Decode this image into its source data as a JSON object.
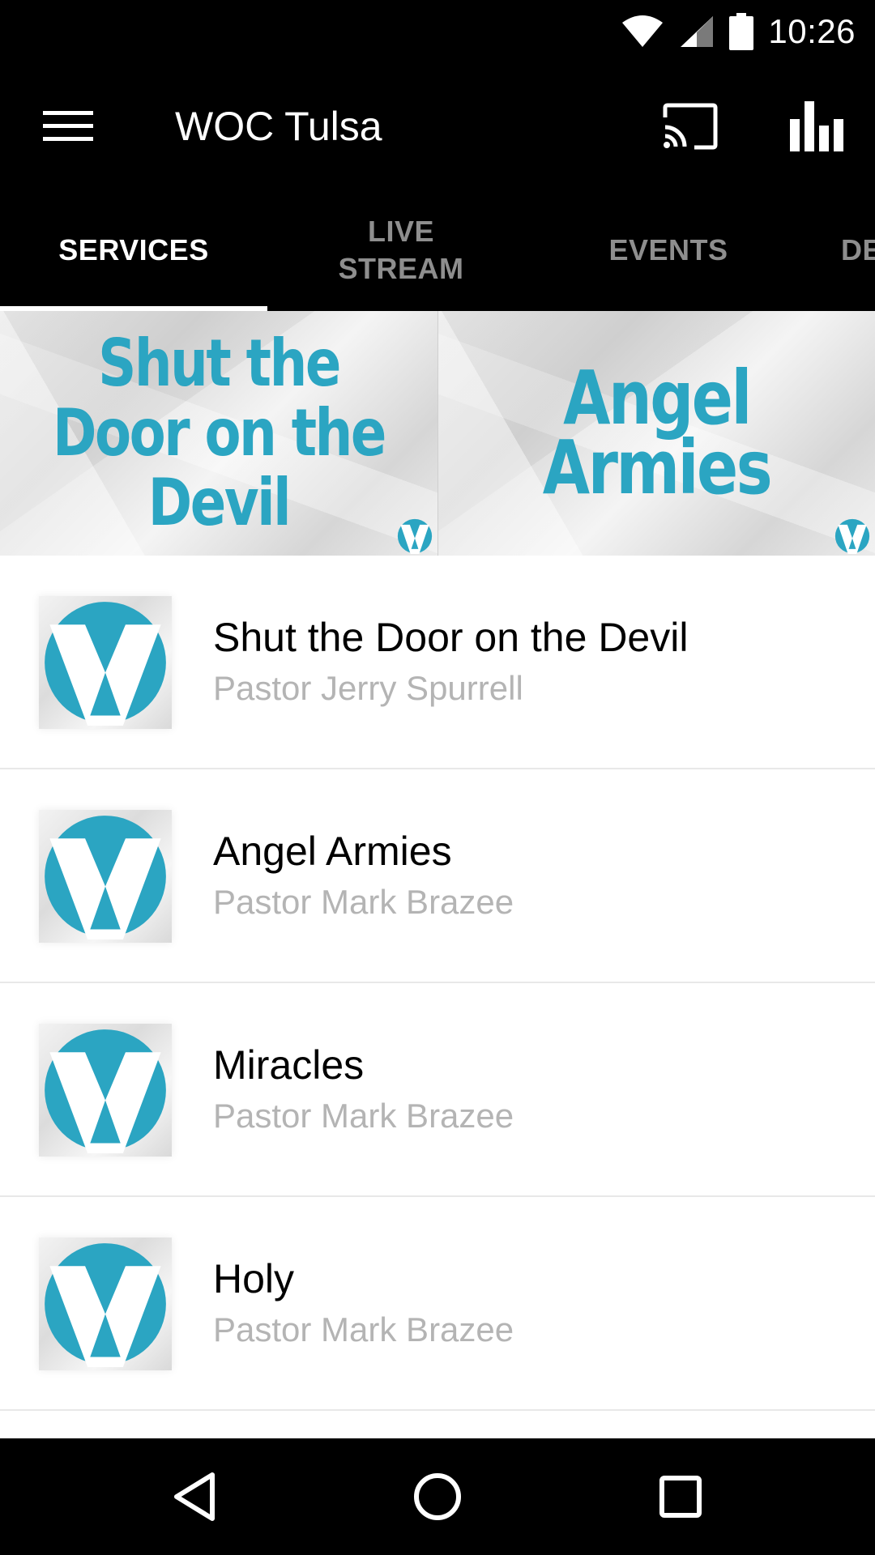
{
  "status_bar": {
    "time": "10:26",
    "icons": [
      "wifi-icon",
      "cell-signal-icon",
      "battery-icon"
    ]
  },
  "app_bar": {
    "title": "WOC Tulsa",
    "icons": [
      "menu-icon",
      "cast-icon",
      "bar-chart-icon"
    ]
  },
  "tabs": [
    {
      "label": "SERVICES",
      "active": true
    },
    {
      "label": "LIVE STREAM",
      "active": false
    },
    {
      "label": "EVENTS",
      "active": false
    },
    {
      "label": "DE",
      "active": false
    }
  ],
  "banner": [
    {
      "text": "Shut the Door on the Devil"
    },
    {
      "text": "Angel Armies"
    }
  ],
  "list": [
    {
      "title": "Shut the Door on the Devil",
      "subtitle": "Pastor Jerry Spurrell"
    },
    {
      "title": "Angel Armies",
      "subtitle": "Pastor Mark Brazee"
    },
    {
      "title": "Miracles",
      "subtitle": "Pastor Mark Brazee"
    },
    {
      "title": "Holy",
      "subtitle": "Pastor Mark Brazee"
    }
  ],
  "nav_bar": {
    "icons": [
      "back-icon",
      "home-icon",
      "recents-icon"
    ]
  },
  "colors": {
    "accent": "#2ba5c2",
    "bar_background": "#000000",
    "subtitle_gray": "#b4b4b4",
    "inactive_tab": "#8e8e8e"
  }
}
